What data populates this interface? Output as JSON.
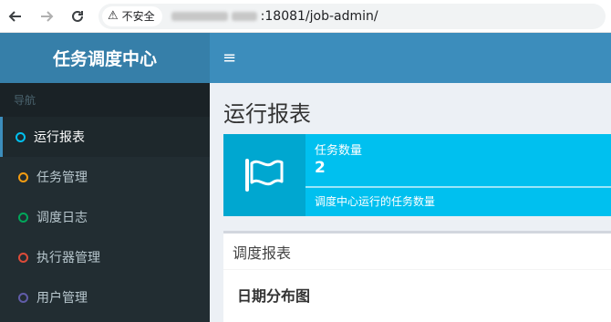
{
  "browser": {
    "security_label": "不安全",
    "url_visible": ":18081/job-admin/"
  },
  "header": {
    "logo_text": "任务调度中心",
    "menu_toggle": "≡"
  },
  "sidebar": {
    "section_label": "导航",
    "items": [
      {
        "label": "运行报表",
        "color": "#00c0ef",
        "active": true
      },
      {
        "label": "任务管理",
        "color": "#f39c12",
        "active": false
      },
      {
        "label": "调度日志",
        "color": "#00a65a",
        "active": false
      },
      {
        "label": "执行器管理",
        "color": "#dd4b39",
        "active": false
      },
      {
        "label": "用户管理",
        "color": "#605ca8",
        "active": false
      }
    ]
  },
  "main": {
    "page_title": "运行报表",
    "info_box": {
      "label": "任务数量",
      "number": "2",
      "description": "调度中心运行的任务数量",
      "icon": "flag-icon",
      "color": "#00c0ef"
    },
    "report_box": {
      "title": "调度报表",
      "subtitle": "日期分布图"
    }
  }
}
